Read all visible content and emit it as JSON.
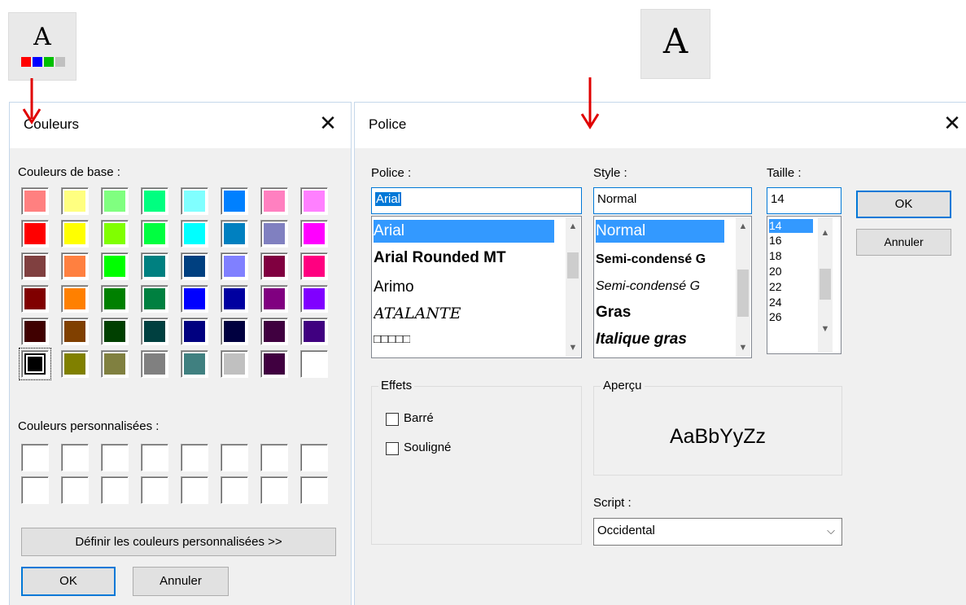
{
  "toolbar": {
    "colors_icon_letter": "A",
    "colors_icon_swatches": [
      "#ff0000",
      "#0000ff",
      "#00c000",
      "#c0c0c0"
    ],
    "font_icon_letter": "A"
  },
  "colors_dialog": {
    "title": "Couleurs",
    "close_glyph": "✕",
    "basic_label": "Couleurs de base :",
    "basic_colors": [
      [
        "#ff8080",
        "#ffff80",
        "#80ff80",
        "#00ff80",
        "#80ffff",
        "#0080ff",
        "#ff80c0",
        "#ff80ff"
      ],
      [
        "#ff0000",
        "#ffff00",
        "#80ff00",
        "#00ff40",
        "#00ffff",
        "#0080c0",
        "#8080c0",
        "#ff00ff"
      ],
      [
        "#804040",
        "#ff8040",
        "#00ff00",
        "#008080",
        "#004080",
        "#8080ff",
        "#800040",
        "#ff0080"
      ],
      [
        "#800000",
        "#ff8000",
        "#008000",
        "#008040",
        "#0000ff",
        "#0000a0",
        "#800080",
        "#8000ff"
      ],
      [
        "#400000",
        "#804000",
        "#004000",
        "#004040",
        "#000080",
        "#000040",
        "#400040",
        "#400080"
      ],
      [
        "#000000",
        "#808000",
        "#808040",
        "#808080",
        "#408080",
        "#c0c0c0",
        "#400040",
        "#ffffff"
      ]
    ],
    "selected_color": "#000000",
    "custom_label": "Couleurs personnalisées :",
    "define_button": "Définir les couleurs personnalisées >>",
    "ok_button": "OK",
    "cancel_button": "Annuler"
  },
  "font_dialog": {
    "title": "Police",
    "close_glyph": "✕",
    "font_label": "Police :",
    "font_value": "Arial",
    "font_list": [
      "Arial",
      "Arial Rounded MT",
      "Arimo",
      "ATALANTE",
      "□□□□□"
    ],
    "style_label": "Style :",
    "style_value": "Normal",
    "style_list": [
      "Normal",
      "Semi-condensé G",
      "Semi-condensé G",
      "Gras",
      "Italique gras"
    ],
    "size_label": "Taille :",
    "size_value": "14",
    "size_list": [
      "14",
      "16",
      "18",
      "20",
      "22",
      "24",
      "26"
    ],
    "ok_button": "OK",
    "cancel_button": "Annuler",
    "effects_label": "Effets",
    "strike_label": "Barré",
    "underline_label": "Souligné",
    "preview_label": "Aperçu",
    "preview_text": "AaBbYyZz",
    "script_label": "Script :",
    "script_value": "Occidental"
  },
  "colors": {
    "arrow": "#e00000",
    "selection": "#3399ff",
    "accent": "#0078d7"
  }
}
